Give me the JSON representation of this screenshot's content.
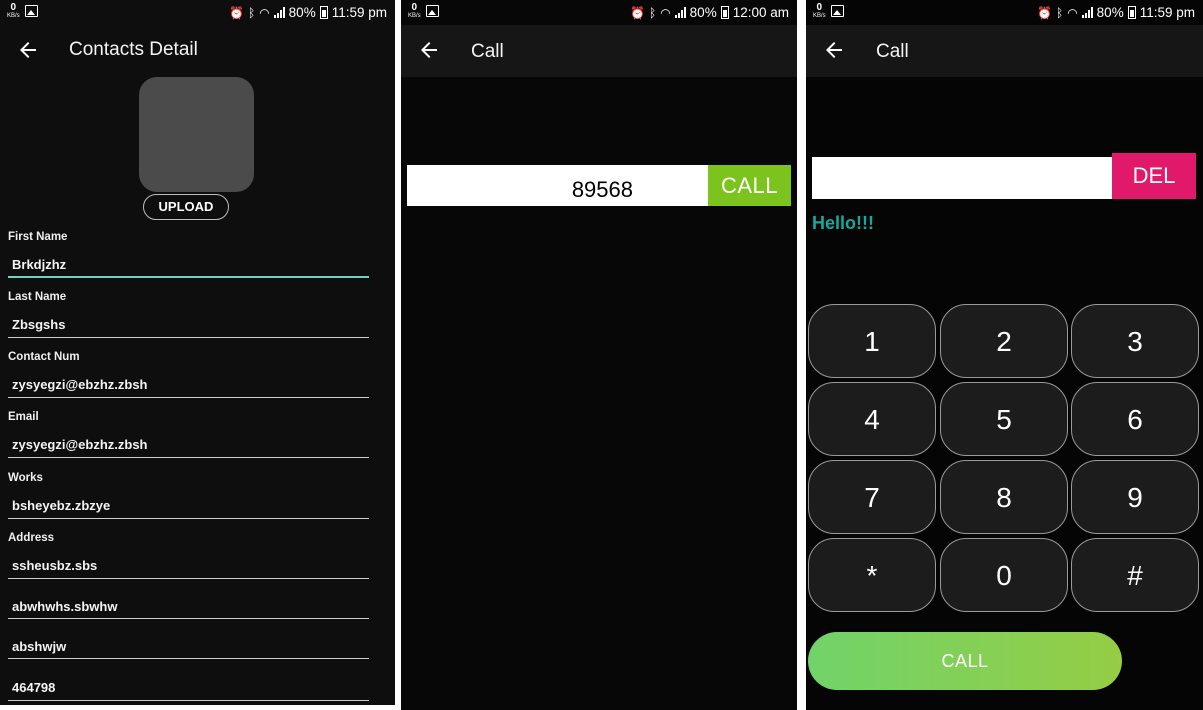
{
  "status": {
    "kb_value": "0",
    "kb_unit": "KB/s",
    "battery_percent": "80%"
  },
  "screen1": {
    "title": "Contacts Detail",
    "time": "11:59 pm",
    "upload_label": "UPLOAD",
    "fields": [
      {
        "label": "First Name",
        "value": "Brkdjzhz"
      },
      {
        "label": "Last Name",
        "value": "Zbsgshs"
      },
      {
        "label": "Contact Num",
        "value": "zysyegzi@ebzhz.zbsh"
      },
      {
        "label": "Email",
        "value": "zysyegzi@ebzhz.zbsh"
      },
      {
        "label": "Works",
        "value": "bsheyebz.zbzye"
      },
      {
        "label": "Address",
        "value": "ssheusbz.sbs"
      }
    ],
    "extra_lines": [
      "abwhwhs.sbwhw",
      "abshwjw",
      "464798"
    ]
  },
  "screen2": {
    "title": "Call",
    "time": "12:00 am",
    "number": "89568",
    "call_label": "CALL"
  },
  "screen3": {
    "title": "Call",
    "time": "11:59 pm",
    "input_value": "",
    "del_label": "DEL",
    "message": "Hello!!!",
    "keys": [
      "1",
      "2",
      "3",
      "4",
      "5",
      "6",
      "7",
      "8",
      "9",
      "*",
      "0",
      "#"
    ],
    "call_label": "CALL"
  },
  "colors": {
    "call_green": "#7dc31e",
    "del_pink": "#e0196a",
    "hello_teal": "#19a89a",
    "active_underline": "#6fd3c7"
  }
}
